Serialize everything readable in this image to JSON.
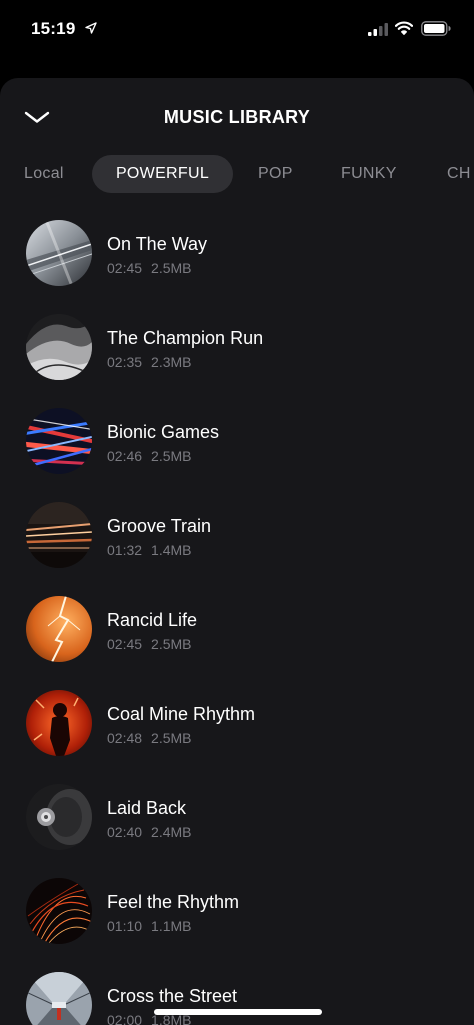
{
  "status_bar": {
    "time": "15:19"
  },
  "header": {
    "title": "MUSIC LIBRARY"
  },
  "tabs": [
    {
      "label": "Local",
      "active": false
    },
    {
      "label": "POWERFUL",
      "active": true
    },
    {
      "label": "POP",
      "active": false
    },
    {
      "label": "FUNKY",
      "active": false
    },
    {
      "label": "CH",
      "active": false
    }
  ],
  "songs": [
    {
      "title": "On The Way",
      "duration": "02:45",
      "size": "2.5MB"
    },
    {
      "title": "The Champion Run",
      "duration": "02:35",
      "size": "2.3MB"
    },
    {
      "title": "Bionic Games",
      "duration": "02:46",
      "size": "2.5MB"
    },
    {
      "title": "Groove Train",
      "duration": "01:32",
      "size": "1.4MB"
    },
    {
      "title": "Rancid Life",
      "duration": "02:45",
      "size": "2.5MB"
    },
    {
      "title": "Coal Mine Rhythm",
      "duration": "02:48",
      "size": "2.5MB"
    },
    {
      "title": "Laid Back",
      "duration": "02:40",
      "size": "2.4MB"
    },
    {
      "title": "Feel the Rhythm",
      "duration": "01:10",
      "size": "1.1MB"
    },
    {
      "title": "Cross the Street",
      "duration": "02:00",
      "size": "1.8MB"
    }
  ],
  "colors": {
    "background": "#000000",
    "sheet": "#17171a",
    "active_tab": "#303034",
    "muted_text": "#7a7a80"
  },
  "icons": [
    "location-arrow-icon",
    "signal-icon",
    "wifi-icon",
    "battery-icon",
    "chevron-down-icon"
  ]
}
